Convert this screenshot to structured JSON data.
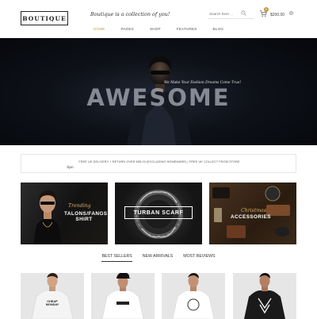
{
  "header": {
    "logo": "BOUTIQUE",
    "tagline": "Boutique is a collection of you!",
    "search_placeholder": "Search here ...",
    "cart_count": "0",
    "cart_total": "$200.00"
  },
  "nav": {
    "items": [
      "HOME",
      "PAGES",
      "SHOP",
      "FEATURES",
      "BLOG"
    ],
    "active": "HOME"
  },
  "hero": {
    "tagline": "We Make Your Fashion Dreams Come True!",
    "title": "AWESOME"
  },
  "delivery": {
    "text": "FREE UK DELIVERY + RETURN OVER £85.00 (EXCLUDING HOMEWARE) | FREE UK COLLECT FROM STORE",
    "signature": "Apo"
  },
  "banners": [
    {
      "script": "Trending",
      "title_line1": "TALONS/FANGS",
      "title_line2": "SHIRT"
    },
    {
      "title": "TURBAN SCARF"
    },
    {
      "script": "Christmas",
      "title": "ACCESSORIES"
    }
  ],
  "product_tabs": {
    "items": [
      "BEST SELLERS",
      "NEW ARRIVALS",
      "MOST REVIEWS"
    ],
    "active": "BEST SELLERS"
  },
  "products": [
    {
      "shirt_line1": "CHEAP",
      "shirt_line2": "MONDAY",
      "shirt_color": "#f4f4f4"
    },
    {
      "shirt_color": "#ffffff"
    },
    {
      "shirt_color": "#ffffff"
    },
    {
      "shirt_color": "#1a1a1a"
    }
  ],
  "colors": {
    "accent": "#c49a3c",
    "dark": "#222222"
  }
}
